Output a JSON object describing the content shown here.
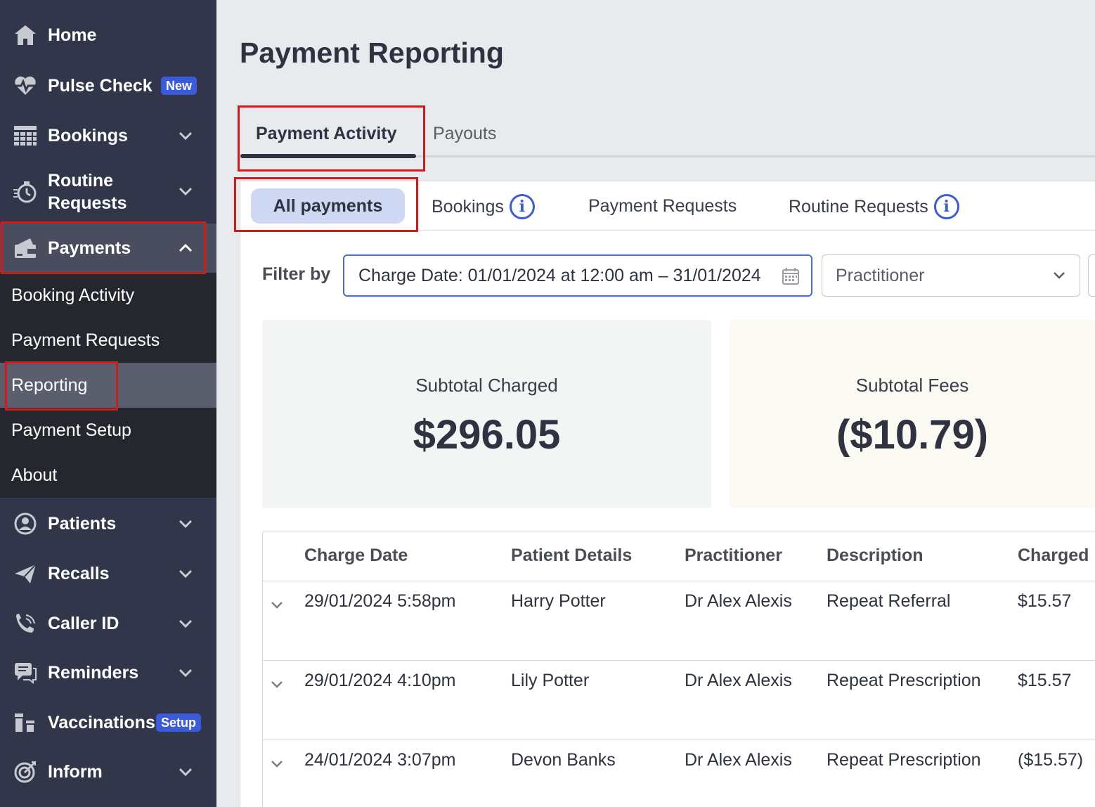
{
  "sidebar": {
    "items": [
      {
        "label": "Home",
        "icon": "home-icon"
      },
      {
        "label": "Pulse Check",
        "badge": "New",
        "icon": "heart-pulse-icon"
      },
      {
        "label": "Bookings",
        "icon": "calendar-grid-icon"
      },
      {
        "label_line1": "Routine",
        "label_line2": "Requests",
        "icon": "stopwatch-icon"
      },
      {
        "label": "Payments",
        "icon": "wallet-icon"
      },
      {
        "label": "Patients",
        "icon": "user-circle-icon"
      },
      {
        "label": "Recalls",
        "icon": "paper-plane-icon"
      },
      {
        "label": "Caller ID",
        "icon": "phone-icon"
      },
      {
        "label": "Reminders",
        "icon": "chat-icon"
      },
      {
        "label": "Vaccinations",
        "badge": "Setup",
        "icon": "vials-icon"
      },
      {
        "label": "Inform",
        "icon": "target-icon"
      }
    ],
    "payments_submenu": [
      "Booking Activity",
      "Payment Requests",
      "Reporting",
      "Payment Setup",
      "About"
    ]
  },
  "main": {
    "title": "Payment Reporting",
    "tabs": [
      "Payment Activity",
      "Payouts"
    ],
    "subtabs": [
      "All payments",
      "Bookings",
      "Payment Requests",
      "Routine Requests"
    ],
    "filter": {
      "label": "Filter by",
      "date_value": "Charge Date: 01/01/2024 at 12:00 am – 31/01/2024",
      "practitioner_placeholder": "Practitioner"
    },
    "cards": [
      {
        "label": "Subtotal Charged",
        "value": "$296.05"
      },
      {
        "label": "Subtotal Fees",
        "value": "($10.79)"
      }
    ],
    "table": {
      "headers": [
        "Charge Date",
        "Patient Details",
        "Practitioner",
        "Description",
        "Charged"
      ],
      "rows": [
        [
          "29/01/2024 5:58pm",
          "Harry Potter",
          "Dr Alex Alexis",
          "Repeat Referral",
          "$15.57"
        ],
        [
          "29/01/2024 4:10pm",
          "Lily Potter",
          "Dr Alex Alexis",
          "Repeat Prescription",
          "$15.57"
        ],
        [
          "24/01/2024 3:07pm",
          "Devon Banks",
          "Dr Alex Alexis",
          "Repeat Prescription",
          "($15.57)"
        ]
      ]
    }
  },
  "colors": {
    "sidebar_bg": "#32364a",
    "accent": "#3b5bdb",
    "highlight_box": "#d11a1a"
  }
}
